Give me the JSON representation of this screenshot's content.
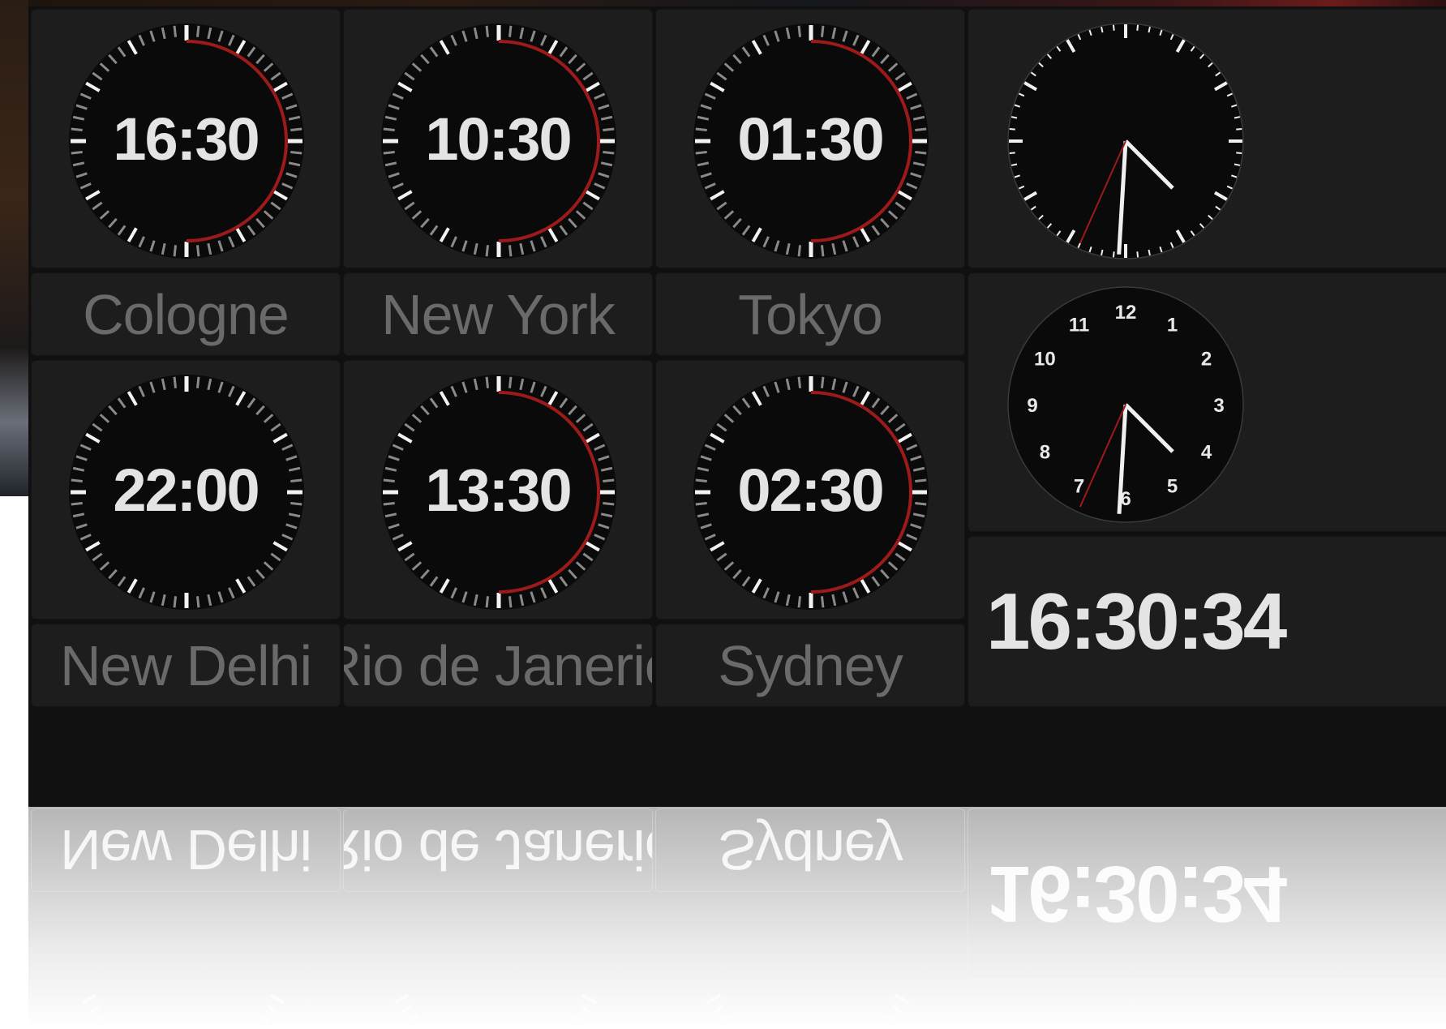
{
  "clocks": [
    {
      "city": "Cologne",
      "time": "16:30",
      "hour": 16,
      "minute": 30
    },
    {
      "city": "New York",
      "time": "10:30",
      "hour": 10,
      "minute": 30
    },
    {
      "city": "Tokyo",
      "time": "01:30",
      "hour": 1,
      "minute": 30
    },
    {
      "city": "New Delhi",
      "time": "22:00",
      "hour": 22,
      "minute": 0
    },
    {
      "city": "Rio de Janerio",
      "time": "13:30",
      "hour": 13,
      "minute": 30
    },
    {
      "city": "Sydney",
      "time": "02:30",
      "hour": 2,
      "minute": 30
    }
  ],
  "local_time": {
    "digital": "16:30:34",
    "hour": 16,
    "minute": 30,
    "second": 34,
    "dial_numbers": [
      "12",
      "1",
      "2",
      "3",
      "4",
      "5",
      "6",
      "7",
      "8",
      "9",
      "10",
      "11"
    ]
  },
  "colors": {
    "accent": "#9c1a1a",
    "tile": "#1d1d1d",
    "dial": "#0a0a0a",
    "text_bright": "#e4e4e4",
    "text_dim": "#6a6a6a"
  }
}
